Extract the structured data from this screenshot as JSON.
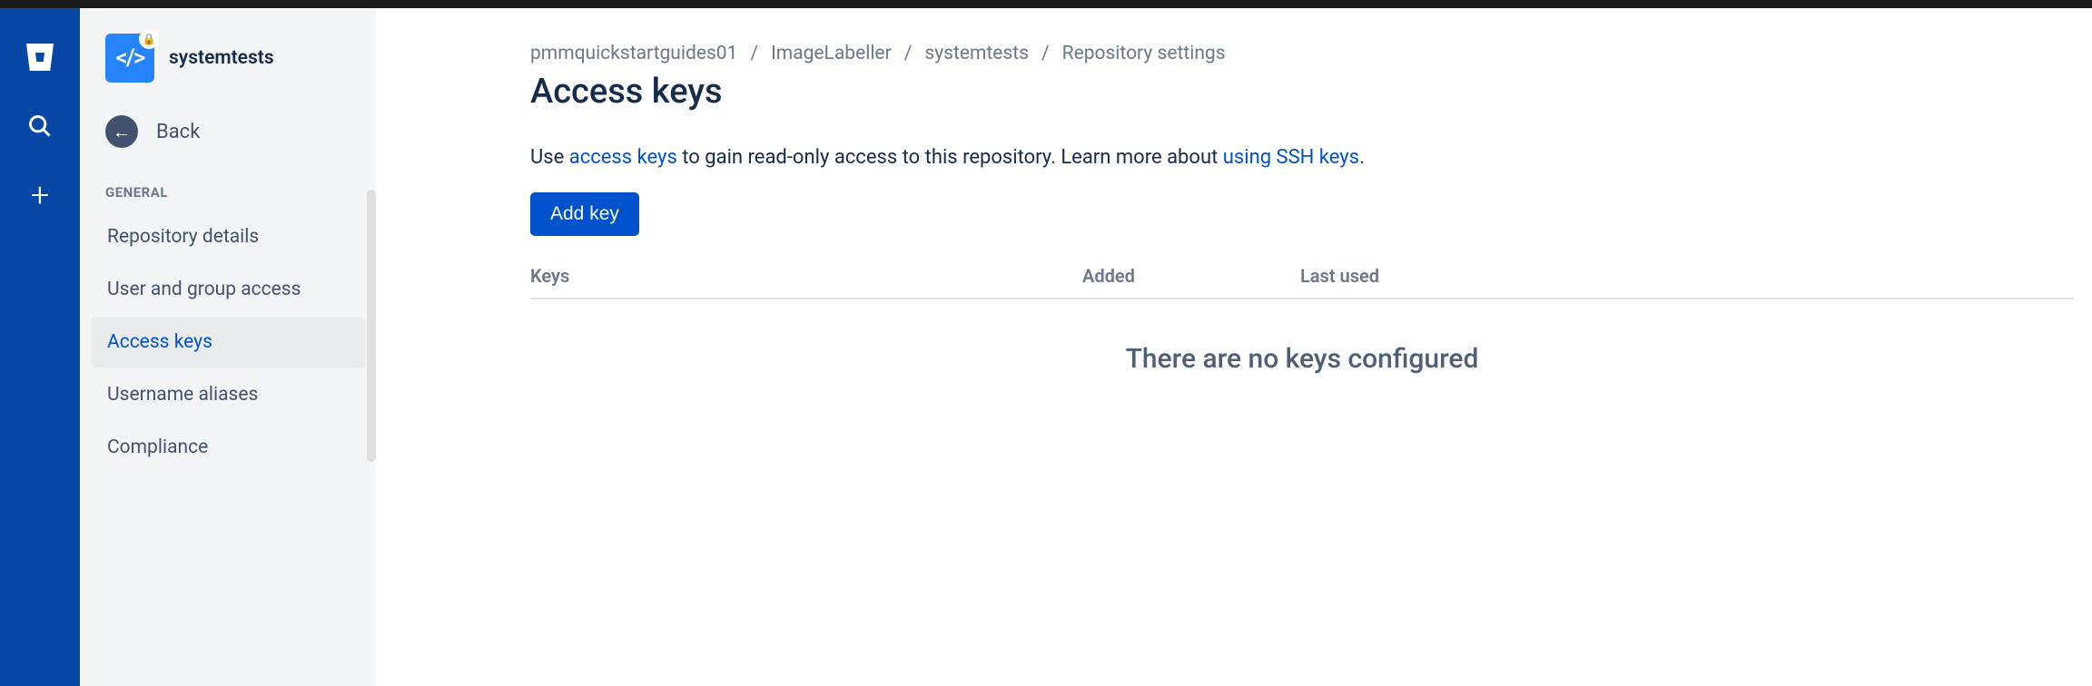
{
  "repo": {
    "name": "systemtests"
  },
  "sidebar": {
    "back_label": "Back",
    "section_label": "GENERAL",
    "items": [
      {
        "label": "Repository details"
      },
      {
        "label": "User and group access"
      },
      {
        "label": "Access keys"
      },
      {
        "label": "Username aliases"
      },
      {
        "label": "Compliance"
      }
    ]
  },
  "breadcrumb": {
    "items": [
      "pmmquickstartguides01",
      "ImageLabeller",
      "systemtests",
      "Repository settings"
    ]
  },
  "page": {
    "title": "Access keys",
    "desc_prefix": "Use ",
    "desc_link1": "access keys",
    "desc_mid": " to gain read-only access to this repository. Learn more about ",
    "desc_link2": "using SSH keys",
    "desc_suffix": "."
  },
  "actions": {
    "add_key": "Add key"
  },
  "table": {
    "col_keys": "Keys",
    "col_added": "Added",
    "col_lastused": "Last used",
    "empty": "There are no keys configured"
  }
}
